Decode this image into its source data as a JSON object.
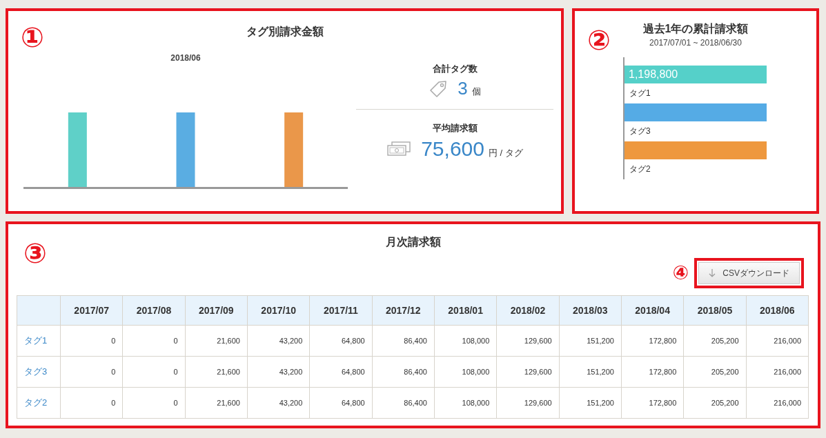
{
  "tag_amount": {
    "marker": "①",
    "title": "タグ別請求金額",
    "chart_month": "2018/06",
    "bars": [
      {
        "color": "#5fd0c8"
      },
      {
        "color": "#5aade2"
      },
      {
        "color": "#ea974a"
      }
    ],
    "tag_count": {
      "label": "合計タグ数",
      "value": "3",
      "unit": "個"
    },
    "average": {
      "label": "平均請求額",
      "value": "75,600",
      "unit": "円 / タグ"
    }
  },
  "cumulative": {
    "marker": "②",
    "title": "過去1年の累計請求額",
    "period": "2017/07/01 ~ 2018/06/30",
    "bars": [
      {
        "label": "タグ1",
        "value_label": "1,198,800",
        "color": "#55d0c9"
      },
      {
        "label": "タグ3",
        "color": "#55abe5"
      },
      {
        "label": "タグ2",
        "color": "#ee983e"
      }
    ]
  },
  "monthly": {
    "marker": "③",
    "title": "月次請求額",
    "download": {
      "marker": "④",
      "label": "CSVダウンロード"
    },
    "columns": [
      "2017/07",
      "2017/08",
      "2017/09",
      "2017/10",
      "2017/11",
      "2017/12",
      "2018/01",
      "2018/02",
      "2018/03",
      "2018/04",
      "2018/05",
      "2018/06"
    ],
    "rows": [
      {
        "tag": "タグ1",
        "values": [
          "0",
          "0",
          "21,600",
          "43,200",
          "64,800",
          "86,400",
          "108,000",
          "129,600",
          "151,200",
          "172,800",
          "205,200",
          "216,000"
        ]
      },
      {
        "tag": "タグ3",
        "values": [
          "0",
          "0",
          "21,600",
          "43,200",
          "64,800",
          "86,400",
          "108,000",
          "129,600",
          "151,200",
          "172,800",
          "205,200",
          "216,000"
        ]
      },
      {
        "tag": "タグ2",
        "values": [
          "0",
          "0",
          "21,600",
          "43,200",
          "64,800",
          "86,400",
          "108,000",
          "129,600",
          "151,200",
          "172,800",
          "205,200",
          "216,000"
        ]
      }
    ]
  }
}
